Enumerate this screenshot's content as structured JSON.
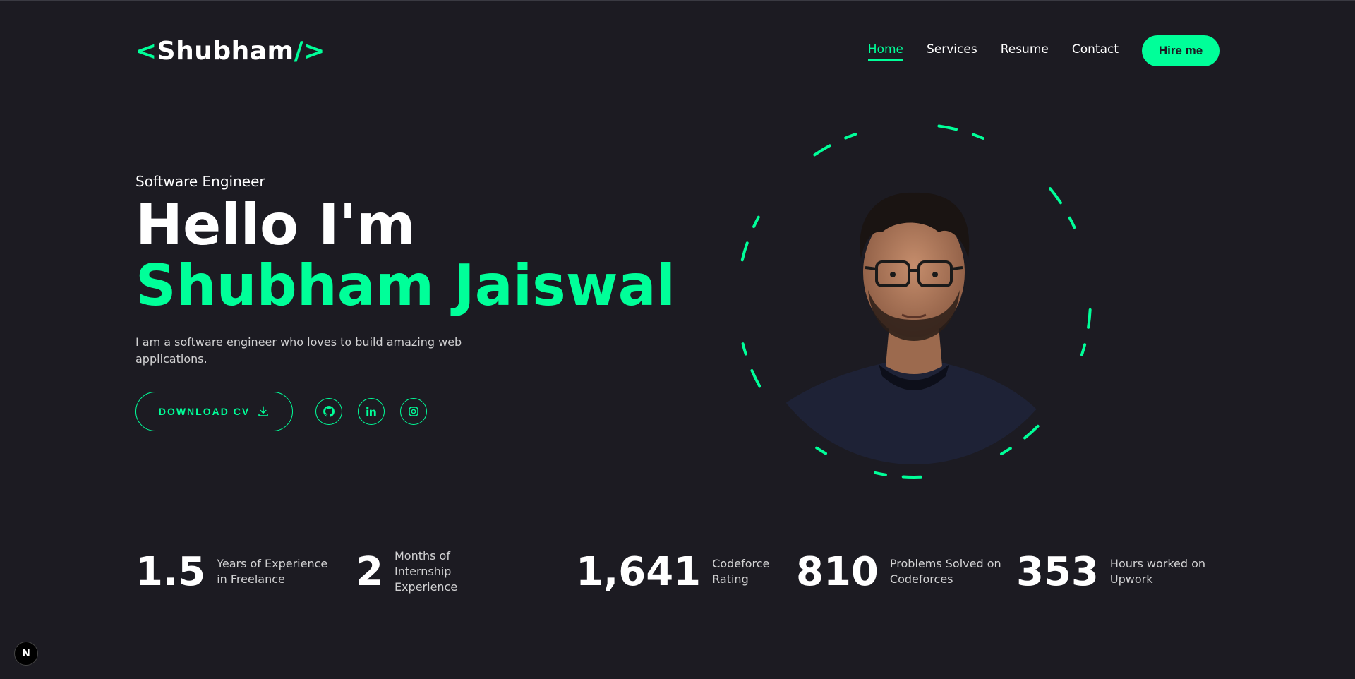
{
  "logo": {
    "open": "<",
    "name": "Shubham",
    "close": "/>"
  },
  "nav": {
    "items": [
      {
        "label": "Home",
        "active": true
      },
      {
        "label": "Services",
        "active": false
      },
      {
        "label": "Resume",
        "active": false
      },
      {
        "label": "Contact",
        "active": false
      }
    ],
    "cta": "Hire me"
  },
  "hero": {
    "subtitle": "Software Engineer",
    "greeting": "Hello I'm",
    "name": "Shubham Jaiswal",
    "description": "I am a software engineer who loves to build amazing web applications.",
    "download_label": "DOWNLOAD CV",
    "download_icon": "download-icon",
    "socials": [
      {
        "icon": "github-icon"
      },
      {
        "icon": "linkedin-icon"
      },
      {
        "icon": "instagram-icon"
      }
    ]
  },
  "stats": [
    {
      "value": "1.5",
      "label_lines": [
        "Years of Experience",
        "in Freelance"
      ]
    },
    {
      "value": "2",
      "label_lines": [
        "Months of",
        "Internship",
        "Experience"
      ]
    },
    {
      "value": "1,641",
      "label_lines": [
        "Codeforce",
        "Rating"
      ]
    },
    {
      "value": "810",
      "label_lines": [
        "Problems Solved on",
        "Codeforces"
      ]
    },
    {
      "value": "353",
      "label_lines": [
        "Hours worked on",
        "Upwork"
      ]
    }
  ],
  "badge": {
    "letter": "N"
  },
  "colors": {
    "background": "#1c1b22",
    "accent": "#00ff99",
    "text": "#ffffff"
  }
}
